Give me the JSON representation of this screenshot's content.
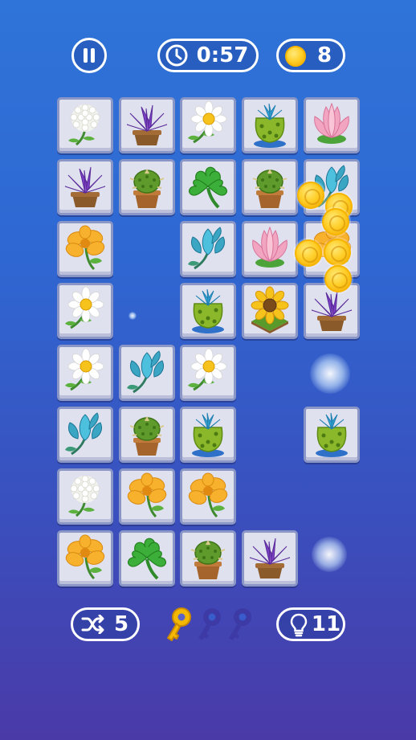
{
  "hud": {
    "timer": "0:57",
    "coins": "8",
    "shuffles": "5",
    "hints": "11",
    "keys_total": 3,
    "keys_collected": 1
  },
  "colors": {
    "background_top": "#2f74d8",
    "background_bottom": "#4a3aa8",
    "tile_face": "#dfe1ee",
    "tile_border": "#8a97c6",
    "coin": "#ffcf2a",
    "key_collected": "#f5b800",
    "key_empty": "#3d3aa6"
  },
  "board": {
    "rows": [
      [
        "dandelion",
        "purple-succulent",
        "daisy",
        "cactus-blue-flower",
        "pink-lotus"
      ],
      [
        "purple-succulent",
        "potted-cactus",
        "clover",
        "potted-cactus",
        "blue-tulip"
      ],
      [
        "yellow-flower",
        null,
        "blue-tulip",
        "pink-lotus",
        "yellow-flower"
      ],
      [
        "daisy",
        null,
        "cactus-blue-flower",
        "sunflower",
        "purple-succulent"
      ],
      [
        "daisy",
        "blue-tulip",
        "daisy",
        null,
        null
      ],
      [
        "blue-tulip",
        "potted-cactus",
        "cactus-blue-flower",
        null,
        "cactus-blue-flower"
      ],
      [
        "dandelion",
        "yellow-flower",
        "yellow-flower",
        null,
        null
      ],
      [
        "yellow-flower",
        "clover",
        "potted-cactus",
        "purple-succulent",
        null
      ]
    ]
  }
}
